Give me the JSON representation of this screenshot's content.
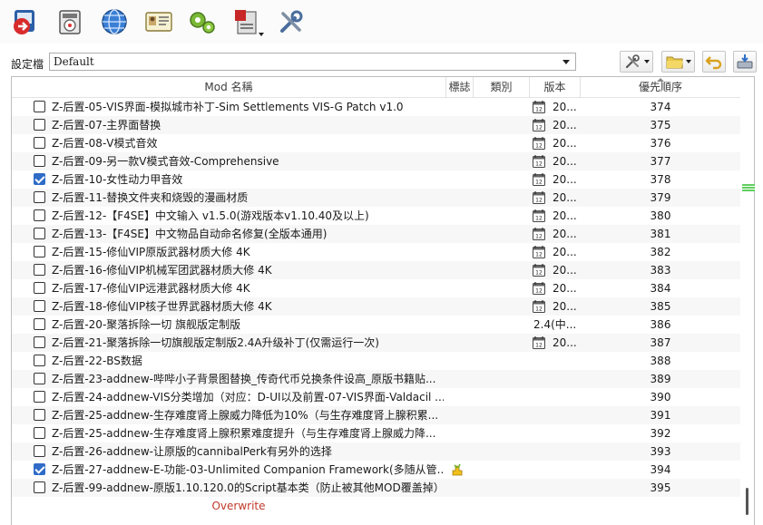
{
  "toolbar": {
    "items": [
      {
        "name": "change-game-icon"
      },
      {
        "name": "install-mod-icon"
      },
      {
        "name": "nexus-globe-icon"
      },
      {
        "name": "profiles-icon"
      },
      {
        "name": "executables-icon"
      },
      {
        "name": "tools-icon"
      },
      {
        "name": "settings-icon"
      }
    ]
  },
  "profile": {
    "label": "設定檔",
    "selected": "Default"
  },
  "list": {
    "headers": {
      "name": "Mod 名稱",
      "flags": "標誌",
      "category": "類別",
      "version": "版本",
      "priority": "優先順序"
    },
    "rows": [
      {
        "name": "Z-后置-05-VIS界面-模拟城市补丁-Sim Settlements VIS-G Patch v1.0",
        "checked": false,
        "version": "20...",
        "version_icon": true,
        "priority": "374"
      },
      {
        "name": "Z-后置-07-主界面替换",
        "checked": false,
        "version": "20...",
        "version_icon": true,
        "priority": "375"
      },
      {
        "name": "Z-后置-08-V模式音效",
        "checked": false,
        "version": "20...",
        "version_icon": true,
        "priority": "376"
      },
      {
        "name": "Z-后置-09-另一款V模式音效-Comprehensive",
        "checked": false,
        "version": "20...",
        "version_icon": true,
        "priority": "377"
      },
      {
        "name": "Z-后置-10-女性动力甲音效",
        "checked": true,
        "version": "20...",
        "version_icon": true,
        "priority": "378"
      },
      {
        "name": "Z-后置-11-替换文件夹和烧毁的漫画材质",
        "checked": false,
        "version": "20...",
        "version_icon": true,
        "priority": "379"
      },
      {
        "name": "Z-后置-12-【F4SE】中文输入 v1.5.0(游戏版本v1.10.40及以上)",
        "checked": false,
        "version": "20...",
        "version_icon": true,
        "priority": "380"
      },
      {
        "name": "Z-后置-13-【F4SE】中文物品自动命名修复(全版本通用)",
        "checked": false,
        "version": "20...",
        "version_icon": true,
        "priority": "381"
      },
      {
        "name": "Z-后置-15-修仙VIP原版武器材质大修 4K",
        "checked": false,
        "version": "20...",
        "version_icon": true,
        "priority": "382"
      },
      {
        "name": "Z-后置-16-修仙VIP机械军团武器材质大修 4K",
        "checked": false,
        "version": "20...",
        "version_icon": true,
        "priority": "383"
      },
      {
        "name": "Z-后置-17-修仙VIP远港武器材质大修 4K",
        "checked": false,
        "version": "20...",
        "version_icon": true,
        "priority": "384"
      },
      {
        "name": "Z-后置-18-修仙VIP核子世界武器材质大修 4K",
        "checked": false,
        "version": "20...",
        "version_icon": true,
        "priority": "385"
      },
      {
        "name": "Z-后置-20-聚落拆除一切 旗舰版定制版",
        "checked": false,
        "version": "2.4(中...",
        "version_icon": false,
        "priority": "386"
      },
      {
        "name": "Z-后置-21-聚落拆除一切旗舰版定制版2.4A升级补丁(仅需运行一次)",
        "checked": false,
        "version": "20...",
        "version_icon": true,
        "priority": "387"
      },
      {
        "name": "Z-后置-22-BS数据",
        "checked": false,
        "version": "",
        "version_icon": false,
        "priority": "388"
      },
      {
        "name": "Z-后置-23-addnew-哔哔小子背景图替换_传奇代币兑换条件设高_原版书籍贴...",
        "checked": false,
        "version": "",
        "version_icon": false,
        "priority": "389"
      },
      {
        "name": "Z-后置-24-addnew-VIS分类增加（对应：D-UI以及前置-07-VIS界面-Valdacil ...",
        "checked": false,
        "version": "",
        "version_icon": false,
        "priority": "390"
      },
      {
        "name": "Z-后置-25-addnew-生存难度肾上腺威力降低为10%（与生存难度肾上腺积累...",
        "checked": false,
        "version": "",
        "version_icon": false,
        "priority": "391"
      },
      {
        "name": "Z-后置-25-addnew-生存难度肾上腺积累难度提升（与生存难度肾上腺威力降...",
        "checked": false,
        "version": "",
        "version_icon": false,
        "priority": "392"
      },
      {
        "name": "Z-后置-26-addnew-让原版的cannibalPerk有另外的选择",
        "checked": false,
        "version": "",
        "version_icon": false,
        "priority": "393"
      },
      {
        "name": "Z-后置-27-addnew-E-功能-03-Unlimited Companion Framework(多随从管...",
        "checked": true,
        "flag_icon": "puzzle-flag-icon",
        "version": "",
        "version_icon": false,
        "priority": "394"
      },
      {
        "name": "Z-后置-99-addnew-原版1.10.120.0的Script基本类（防止被其他MOD覆盖掉）",
        "checked": false,
        "version": "",
        "version_icon": false,
        "priority": "395"
      }
    ],
    "overwrite_label": "Overwrite"
  },
  "colors": {
    "checkbox_checked": "#2f6bc7",
    "overwrite_text": "#c0392b",
    "conflict_marker": "#5fcf5f"
  }
}
